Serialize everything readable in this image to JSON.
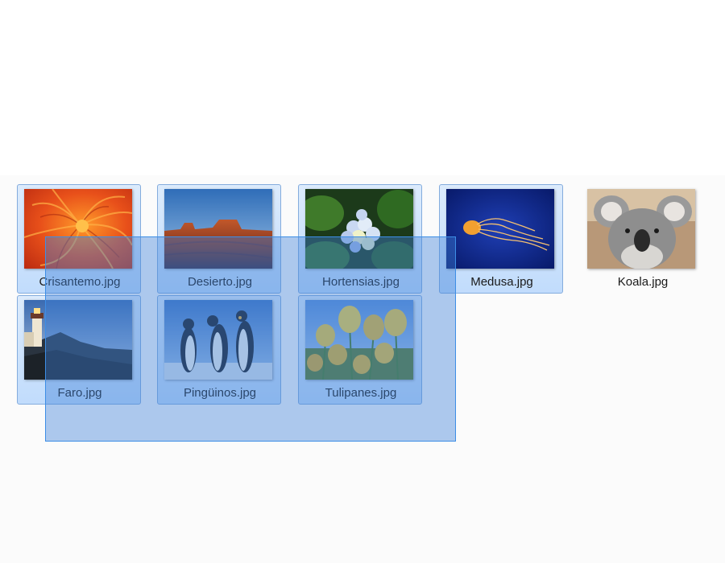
{
  "files": [
    {
      "name": "Crisantemo.jpg",
      "selected": true,
      "thumbnail": "chrysanthemum-image"
    },
    {
      "name": "Desierto.jpg",
      "selected": true,
      "thumbnail": "desert-image"
    },
    {
      "name": "Hortensias.jpg",
      "selected": true,
      "thumbnail": "hydrangeas-image"
    },
    {
      "name": "Medusa.jpg",
      "selected": true,
      "thumbnail": "jellyfish-image"
    },
    {
      "name": "Koala.jpg",
      "selected": false,
      "thumbnail": "koala-image"
    },
    {
      "name": "Faro.jpg",
      "selected": true,
      "thumbnail": "lighthouse-image"
    },
    {
      "name": "Pingüinos.jpg",
      "selected": true,
      "thumbnail": "penguins-image"
    },
    {
      "name": "Tulipanes.jpg",
      "selected": true,
      "thumbnail": "tulips-image"
    }
  ],
  "colors": {
    "selection_border": "#84acdd",
    "selection_fill": "#c9e0fc",
    "marquee_border": "#3d8ee6",
    "marquee_fill": "#3d80d9"
  }
}
